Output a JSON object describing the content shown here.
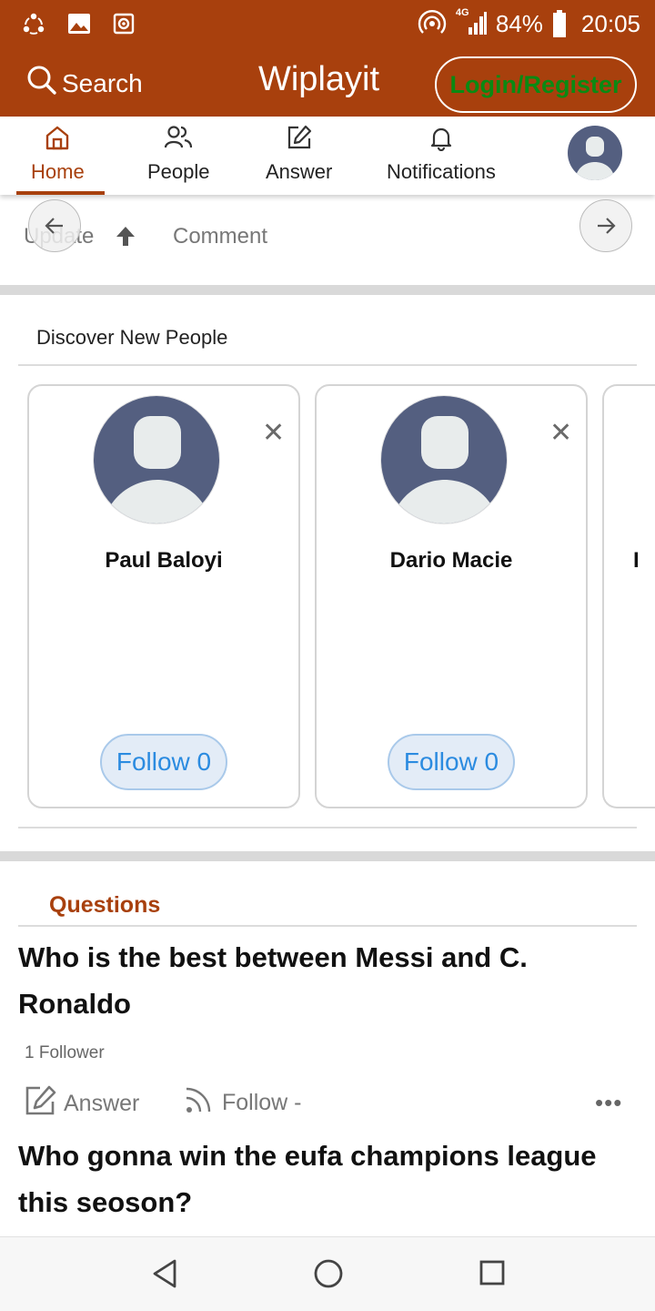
{
  "status_bar": {
    "network": "4G",
    "battery_percent": "84%",
    "battery_level": 0.84,
    "time": "20:05",
    "left_icons": [
      "sync-icon",
      "image-icon",
      "camera-icon"
    ]
  },
  "app_bar": {
    "search_label": "Search",
    "brand": "Wiplayit",
    "login_label": "Login/Register",
    "colors": {
      "primary": "#a8400d",
      "login_text": "#0a8a13"
    }
  },
  "tabs": [
    {
      "label": "Home",
      "icon": "home-icon",
      "active": true
    },
    {
      "label": "People",
      "icon": "people-icon",
      "active": false
    },
    {
      "label": "Answer",
      "icon": "edit-icon",
      "active": false
    },
    {
      "label": "Notifications",
      "icon": "bell-icon",
      "active": false
    }
  ],
  "feed_actions": {
    "update_label": "Update",
    "comment_label": "Comment"
  },
  "discover": {
    "title": "Discover New People",
    "people": [
      {
        "name": "Paul Baloyi",
        "follow_label": "Follow 0"
      },
      {
        "name": "Dario Macie",
        "follow_label": "Follow 0"
      }
    ],
    "peek_char": "I"
  },
  "questions": {
    "section_title": "Questions",
    "items": [
      {
        "title": "Who is the best between Messi and C. Ronaldo",
        "followers": "1 Follower",
        "answer_label": "Answer",
        "follow_label": "Follow -"
      },
      {
        "title": "Who gonna win the eufa champions league this seoson?"
      }
    ]
  },
  "more_label": "•••"
}
